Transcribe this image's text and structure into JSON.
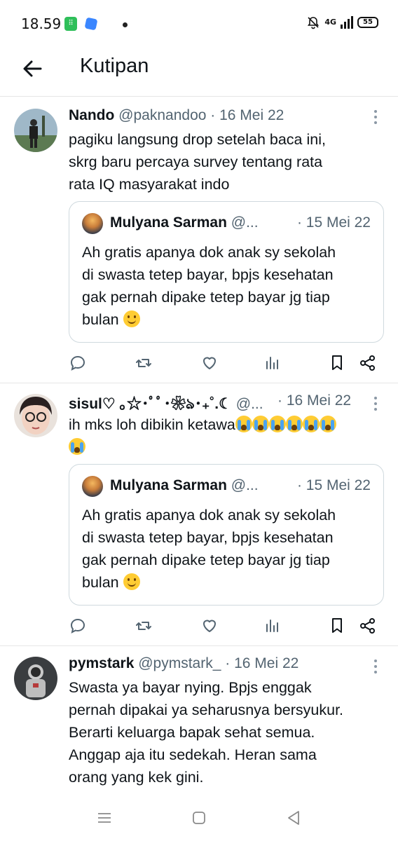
{
  "status_bar": {
    "time": "18.59",
    "network": "4G",
    "battery": "55"
  },
  "header": {
    "title": "Kutipan"
  },
  "tweets": [
    {
      "name": "Nando",
      "handle": "@paknandoo",
      "date": "· 16 Mei 22",
      "lines": [
        "pagiku langsung drop setelah baca ini,",
        "skrg baru percaya survey tentang rata",
        "rata IQ masyarakat indo"
      ],
      "quote": {
        "name": "Mulyana Sarman",
        "handle": "@...",
        "date": "· 15 Mei 22",
        "lines": [
          "Ah gratis apanya dok anak sy sekolah",
          "di swasta tetep bayar, bpjs kesehatan",
          "gak pernah dipake tetep bayar jg tiap",
          "bulan"
        ],
        "emoji": "smiling-face"
      }
    },
    {
      "name": "sisul♡ ｡☆･ﾟﾟ･❀ঌ･₊˚.☾",
      "handle": "@...",
      "date": "· 16 Mei 22",
      "lines": [
        "ih mks loh dibikin ketawa"
      ],
      "emoji_count": 7,
      "emoji": "loudly-crying-face",
      "quote": {
        "name": "Mulyana Sarman",
        "handle": "@...",
        "date": "· 15 Mei 22",
        "lines": [
          "Ah gratis apanya dok anak sy sekolah",
          "di swasta tetep bayar, bpjs kesehatan",
          "gak pernah dipake tetep bayar jg tiap",
          "bulan"
        ],
        "emoji": "smiling-face"
      }
    },
    {
      "name": "pymstark",
      "handle": "@pymstark_",
      "date": "· 16 Mei 22",
      "lines": [
        "Swasta ya bayar nying. Bpjs enggak",
        "pernah dipakai ya seharusnya bersyukur.",
        "Berarti keluarga bapak sehat semua.",
        "Anggap aja itu sedekah. Heran sama",
        "orang yang kek gini."
      ]
    }
  ],
  "icons": {
    "reply": "reply-icon",
    "retweet": "retweet-icon",
    "like": "heart-icon",
    "views": "views-icon",
    "bookmark": "bookmark-icon",
    "share": "share-icon"
  },
  "colors": {
    "text": "#0f1419",
    "secondary": "#536471",
    "border": "#cfd9de",
    "divider": "#e6e6e6"
  }
}
